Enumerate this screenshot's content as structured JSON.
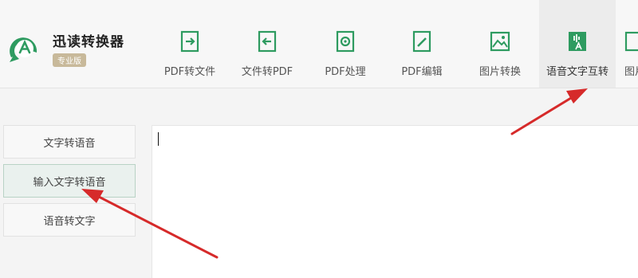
{
  "app": {
    "name": "迅读转换器",
    "edition": "专业版"
  },
  "toolbar": {
    "items": [
      {
        "label": "PDF转文件",
        "icon": "file-export-icon"
      },
      {
        "label": "文件转PDF",
        "icon": "file-import-icon"
      },
      {
        "label": "PDF处理",
        "icon": "pdf-process-icon"
      },
      {
        "label": "PDF编辑",
        "icon": "pdf-edit-icon"
      },
      {
        "label": "图片转换",
        "icon": "image-icon"
      },
      {
        "label": "语音文字互转",
        "icon": "voice-text-icon",
        "active": true
      },
      {
        "label": "图片",
        "icon": "image-icon"
      }
    ]
  },
  "sidebar": {
    "items": [
      {
        "label": "文字转语音"
      },
      {
        "label": "输入文字转语音",
        "active": true
      },
      {
        "label": "语音转文字"
      }
    ]
  },
  "editor": {
    "value": ""
  },
  "colors": {
    "brand_green": "#2e9b60",
    "annotation_red": "#d62a2a",
    "badge": "#c8b99a"
  }
}
